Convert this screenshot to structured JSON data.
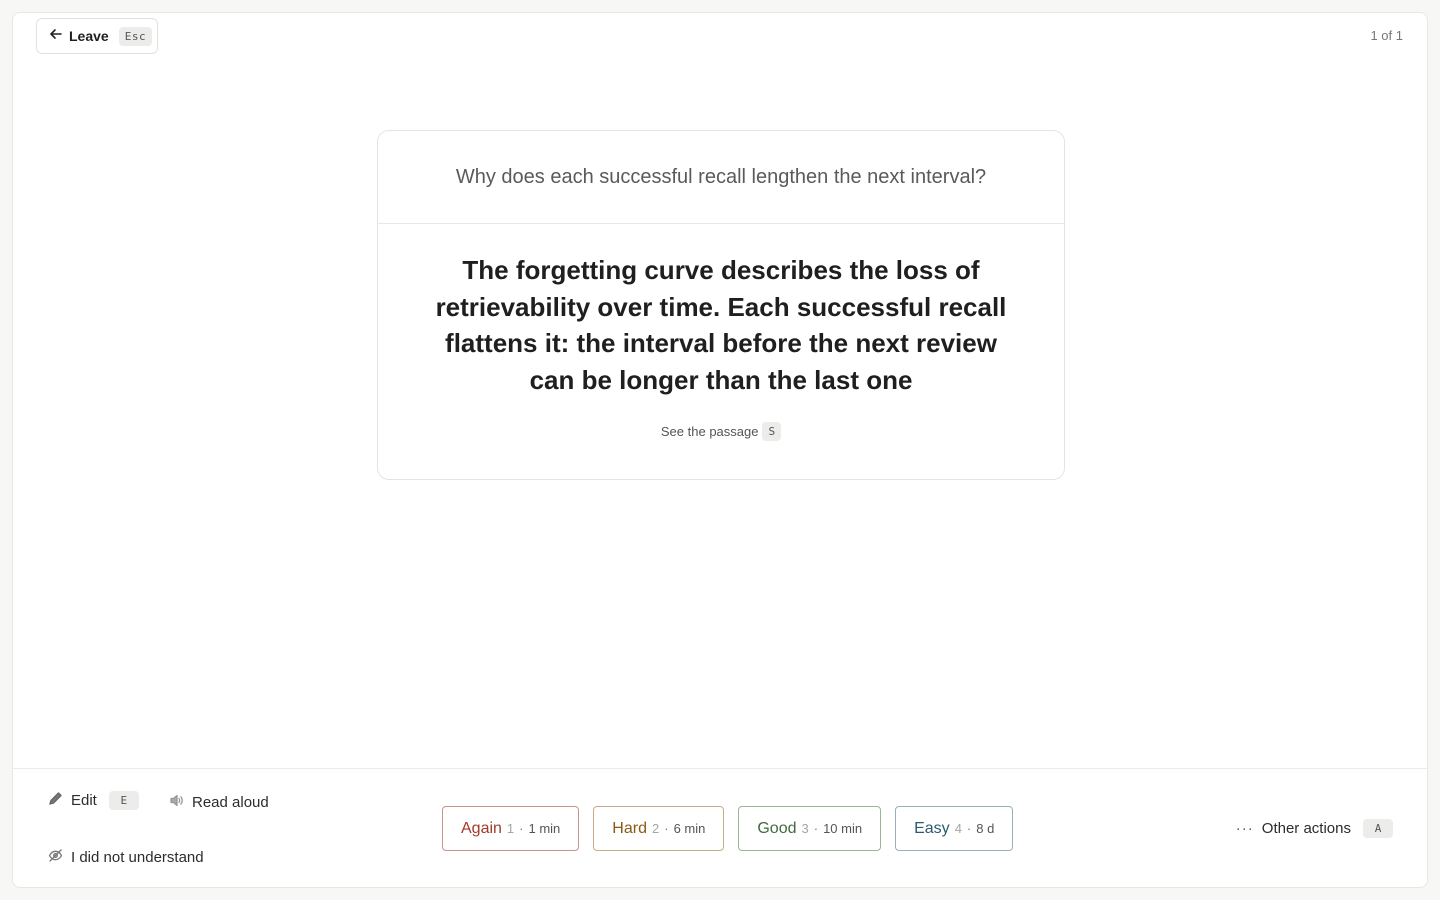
{
  "header": {
    "leave_label": "Leave",
    "leave_shortcut": "Esc",
    "counter": "1 of 1"
  },
  "card": {
    "question": "Why does each successful recall lengthen the next interval?",
    "answer": "The forgetting curve describes the loss of retrievability over time. Each successful recall flattens it: the interval before the next review can be longer than the last one",
    "passage_label": "See the passage",
    "passage_shortcut": "S"
  },
  "footer": {
    "edit_label": "Edit",
    "edit_shortcut": "E",
    "read_aloud_label": "Read aloud",
    "did_not_understand_label": "I did not understand",
    "other_actions_label": "Other actions",
    "other_actions_shortcut": "A"
  },
  "ratings": [
    {
      "label": "Again",
      "key": "1",
      "interval": "1 min",
      "color": "#a33a2a",
      "border": "#c9938a"
    },
    {
      "label": "Hard",
      "key": "2",
      "interval": "6 min",
      "color": "#8a5a14",
      "border": "#c9ab86"
    },
    {
      "label": "Good",
      "key": "3",
      "interval": "10 min",
      "color": "#3f6b3a",
      "border": "#9db39a"
    },
    {
      "label": "Easy",
      "key": "4",
      "interval": "8 d",
      "color": "#2d5a6e",
      "border": "#9aafb8"
    }
  ]
}
